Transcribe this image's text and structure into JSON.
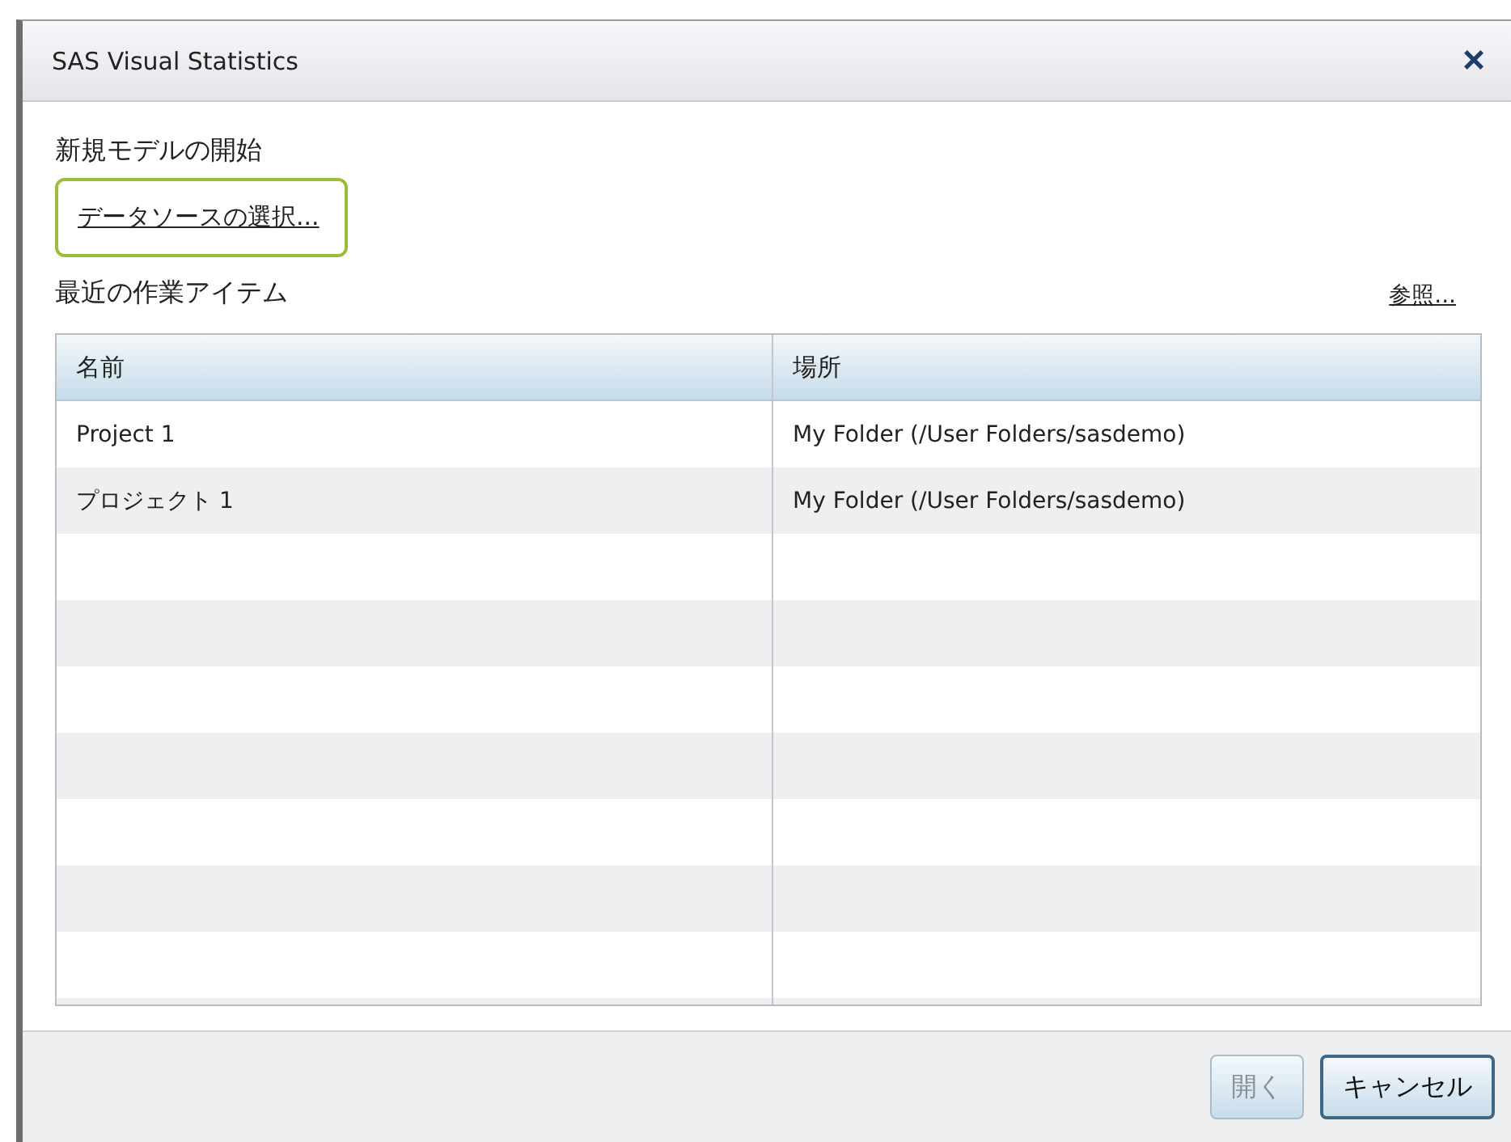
{
  "window": {
    "title": "SAS Visual Statistics",
    "close": "×"
  },
  "new_model": {
    "heading": "新規モデルの開始",
    "link": {
      "label": "データソースの選択...",
      "focused": true
    }
  },
  "recent": {
    "heading": "最近の作業アイテム",
    "browse": "参照..."
  },
  "table": {
    "columns": [
      "名前",
      "場所"
    ],
    "rows": [
      [
        "Project 1",
        "My Folder (/User Folders/sasdemo)"
      ],
      [
        "プロジェクト 1",
        "My Folder (/User Folders/sasdemo)"
      ]
    ]
  },
  "buttons": [
    {
      "label": "開く",
      "disabled": true
    },
    {
      "label": "キャンセル",
      "disabled": false
    }
  ]
}
